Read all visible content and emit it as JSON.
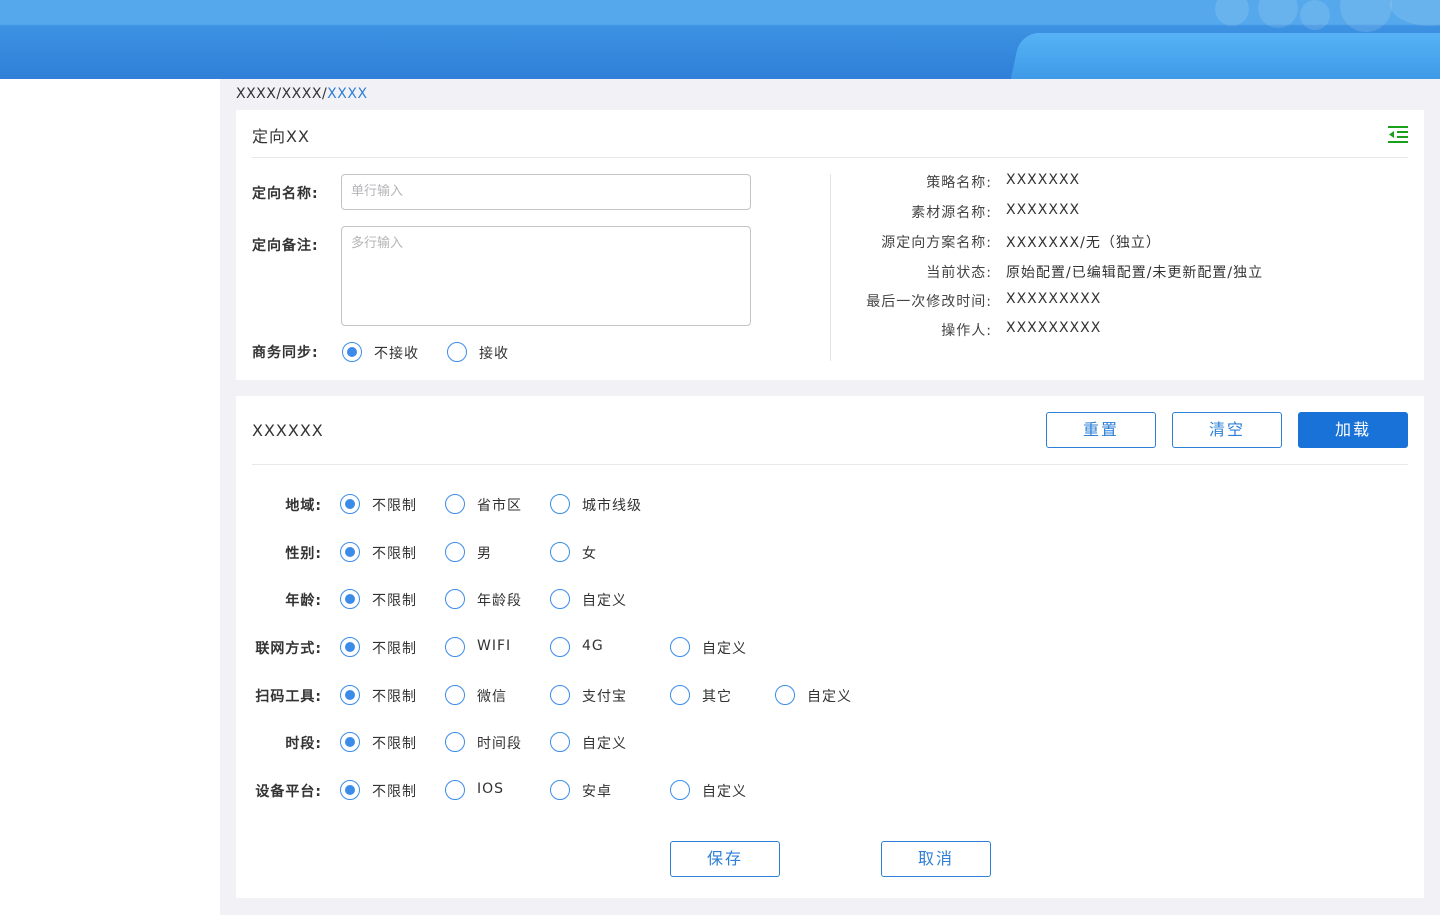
{
  "breadcrumb": {
    "part1": "XXXX/XXXX/",
    "current": "XXXX"
  },
  "panel1": {
    "title": "定向XX",
    "collapse_icon": "outdent-icon",
    "fields": {
      "name_label": "定向名称:",
      "name_placeholder": "单行输入",
      "remark_label": "定向备注:",
      "remark_placeholder": "多行输入",
      "sync_label": "商务同步:",
      "sync_options": [
        "不接收",
        "接收"
      ],
      "sync_selected": "不接收"
    },
    "info": [
      {
        "key": "策略名称:",
        "value": "XXXXXXX"
      },
      {
        "key": "素材源名称:",
        "value": "XXXXXXX"
      },
      {
        "key": "源定向方案名称:",
        "value": "XXXXXXX/无（独立）"
      },
      {
        "key": "当前状态:",
        "value": "原始配置/已编辑配置/未更新配置/独立"
      },
      {
        "key": "最后一次修改时间:",
        "value": "XXXXXXXXX"
      },
      {
        "key": "操作人:",
        "value": "XXXXXXXXX"
      }
    ]
  },
  "panel2": {
    "title": "XXXXXX",
    "buttons": {
      "reset": "重置",
      "clear": "清空",
      "load": "加载"
    },
    "filters": [
      {
        "label": "地域:",
        "options": [
          "不限制",
          "省市区",
          "城市线级"
        ],
        "selected": "不限制"
      },
      {
        "label": "性别:",
        "options": [
          "不限制",
          "男",
          "女"
        ],
        "selected": "不限制"
      },
      {
        "label": "年龄:",
        "options": [
          "不限制",
          "年龄段",
          "自定义"
        ],
        "selected": "不限制"
      },
      {
        "label": "联网方式:",
        "options": [
          "不限制",
          "WIFI",
          "4G",
          "自定义"
        ],
        "selected": "不限制"
      },
      {
        "label": "扫码工具:",
        "options": [
          "不限制",
          "微信",
          "支付宝",
          "其它",
          "自定义"
        ],
        "selected": "不限制"
      },
      {
        "label": "时段:",
        "options": [
          "不限制",
          "时间段",
          "自定义"
        ],
        "selected": "不限制"
      },
      {
        "label": "设备平台:",
        "options": [
          "不限制",
          "IOS",
          "安卓",
          "自定义"
        ],
        "selected": "不限制"
      }
    ],
    "footer": {
      "save": "保存",
      "cancel": "取消"
    }
  },
  "colors": {
    "accent": "#1872d7",
    "header": "#2f7fd8",
    "radio": "#3b8ce8"
  }
}
